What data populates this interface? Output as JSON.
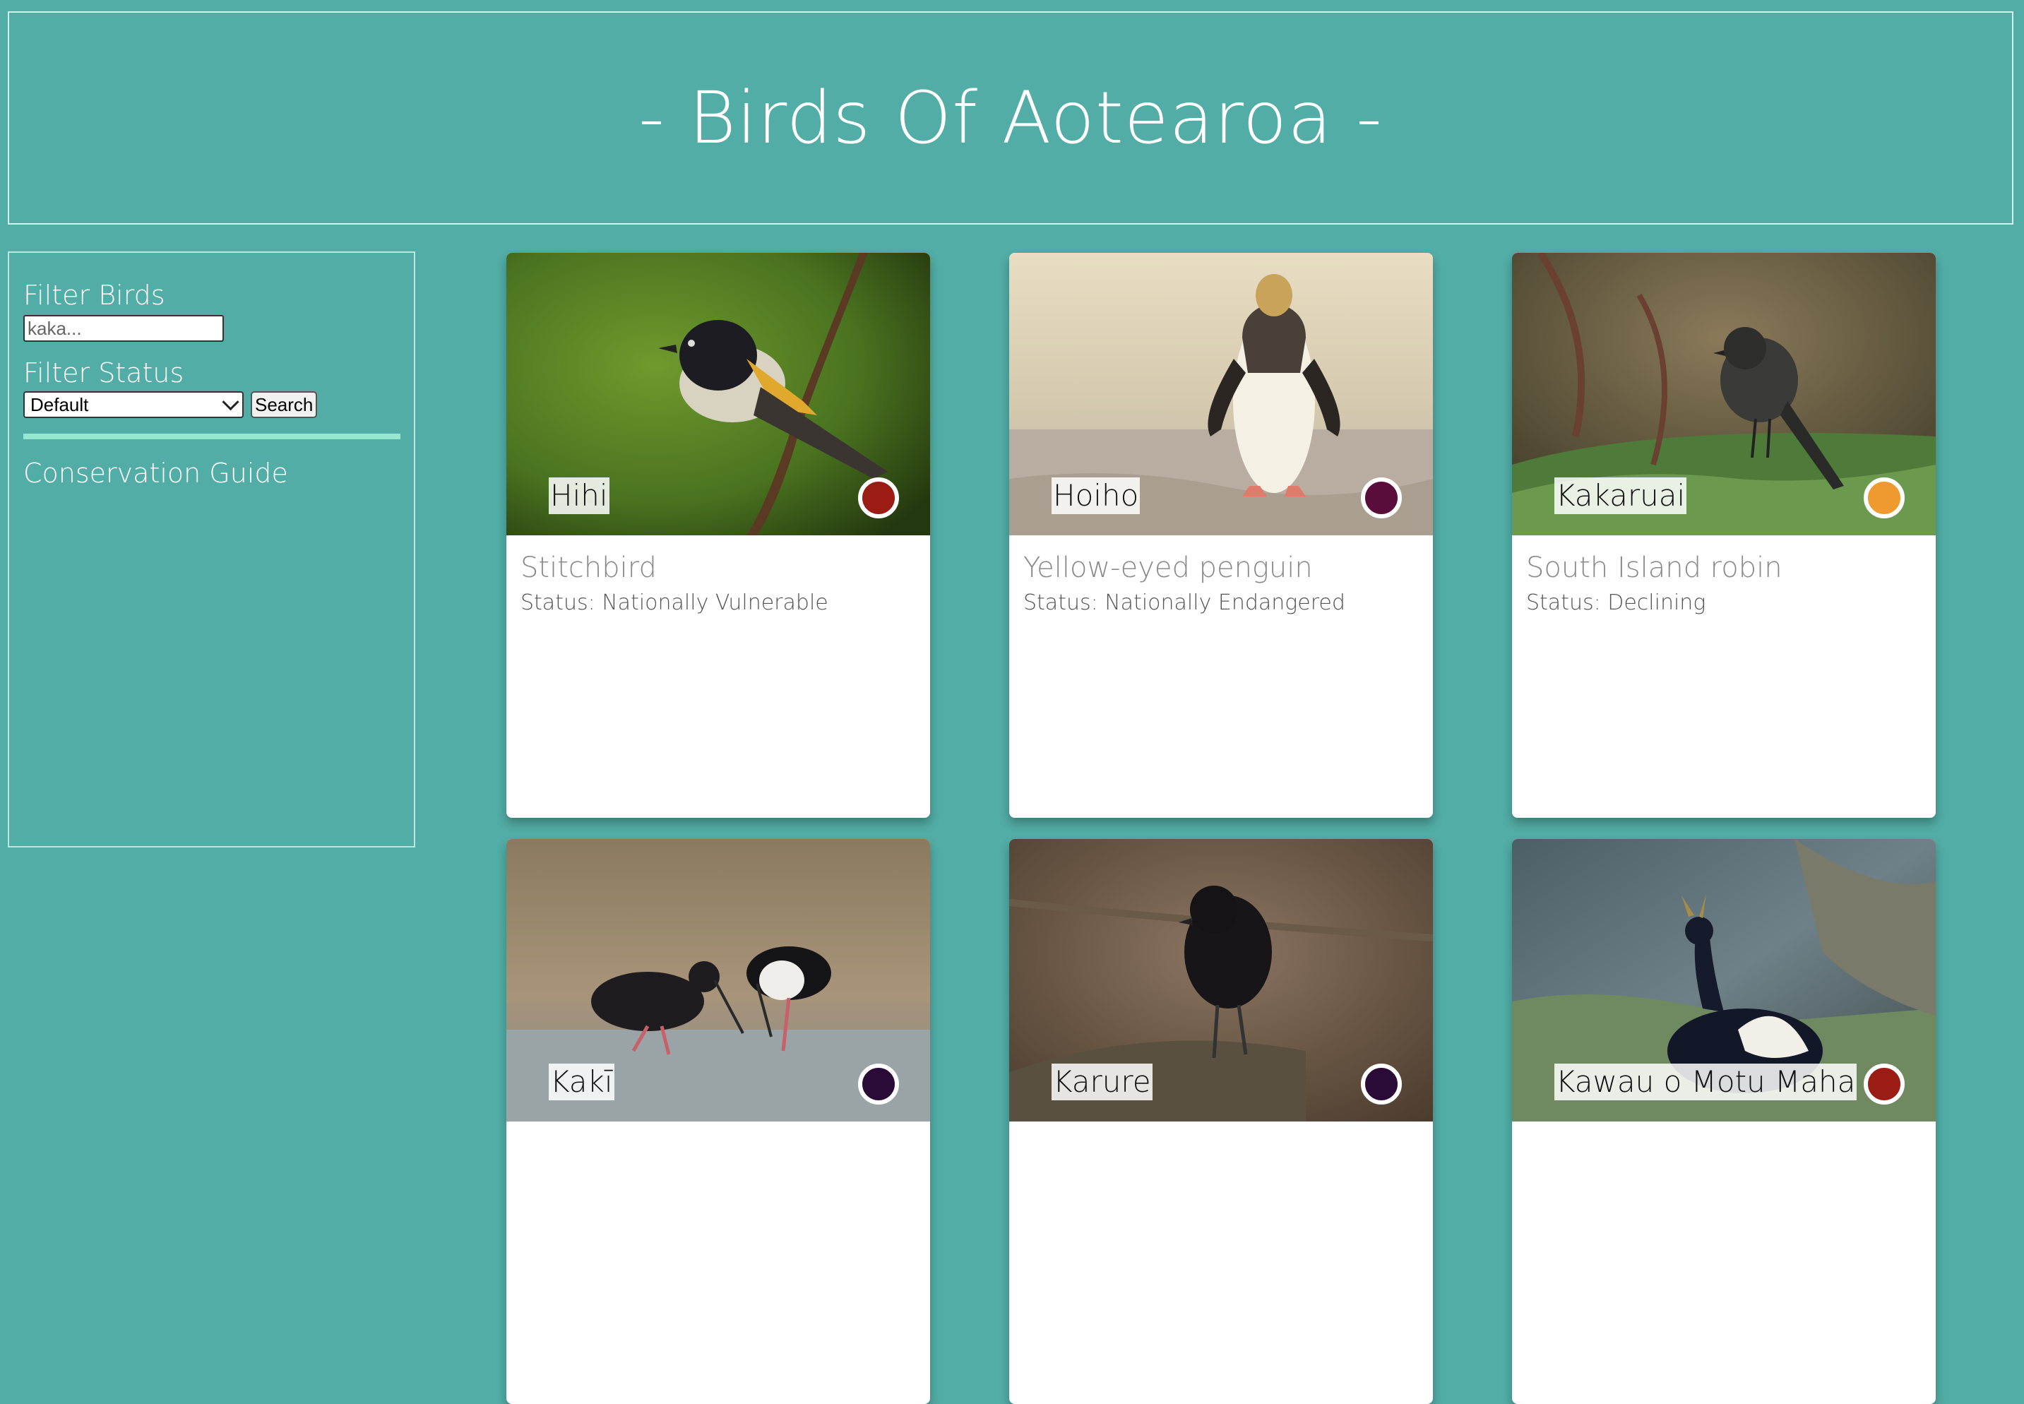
{
  "header": {
    "title": "- Birds Of Aotearoa -"
  },
  "sidebar": {
    "filter_birds_label": "Filter Birds",
    "search_placeholder": "kaka...",
    "filter_status_label": "Filter Status",
    "status_select_value": "Default",
    "search_button_label": "Search",
    "conservation_guide_label": "Conservation Guide"
  },
  "cards": [
    {
      "maori_name": "Hihi",
      "english_name": "Stitchbird",
      "status": "Status: Nationally Vulnerable",
      "status_color": "#9b1c14",
      "photo_icon": "stitchbird-photo"
    },
    {
      "maori_name": "Hoiho",
      "english_name": "Yellow-eyed penguin",
      "status": "Status: Nationally Endangered",
      "status_color": "#5a0d3a",
      "photo_icon": "penguin-photo"
    },
    {
      "maori_name": "Kakaruai",
      "english_name": "South Island robin",
      "status": "Status: Declining",
      "status_color": "#ef9a2e",
      "photo_icon": "robin-photo"
    },
    {
      "maori_name": "Kakī",
      "english_name": "",
      "status": "",
      "status_color": "#2a0a36",
      "photo_icon": "stilt-photo"
    },
    {
      "maori_name": "Karure",
      "english_name": "",
      "status": "",
      "status_color": "#2a0a36",
      "photo_icon": "black-robin-photo"
    },
    {
      "maori_name": "Kawau o Motu Maha",
      "english_name": "",
      "status": "",
      "status_color": "#9b1c14",
      "photo_icon": "shag-photo"
    }
  ]
}
